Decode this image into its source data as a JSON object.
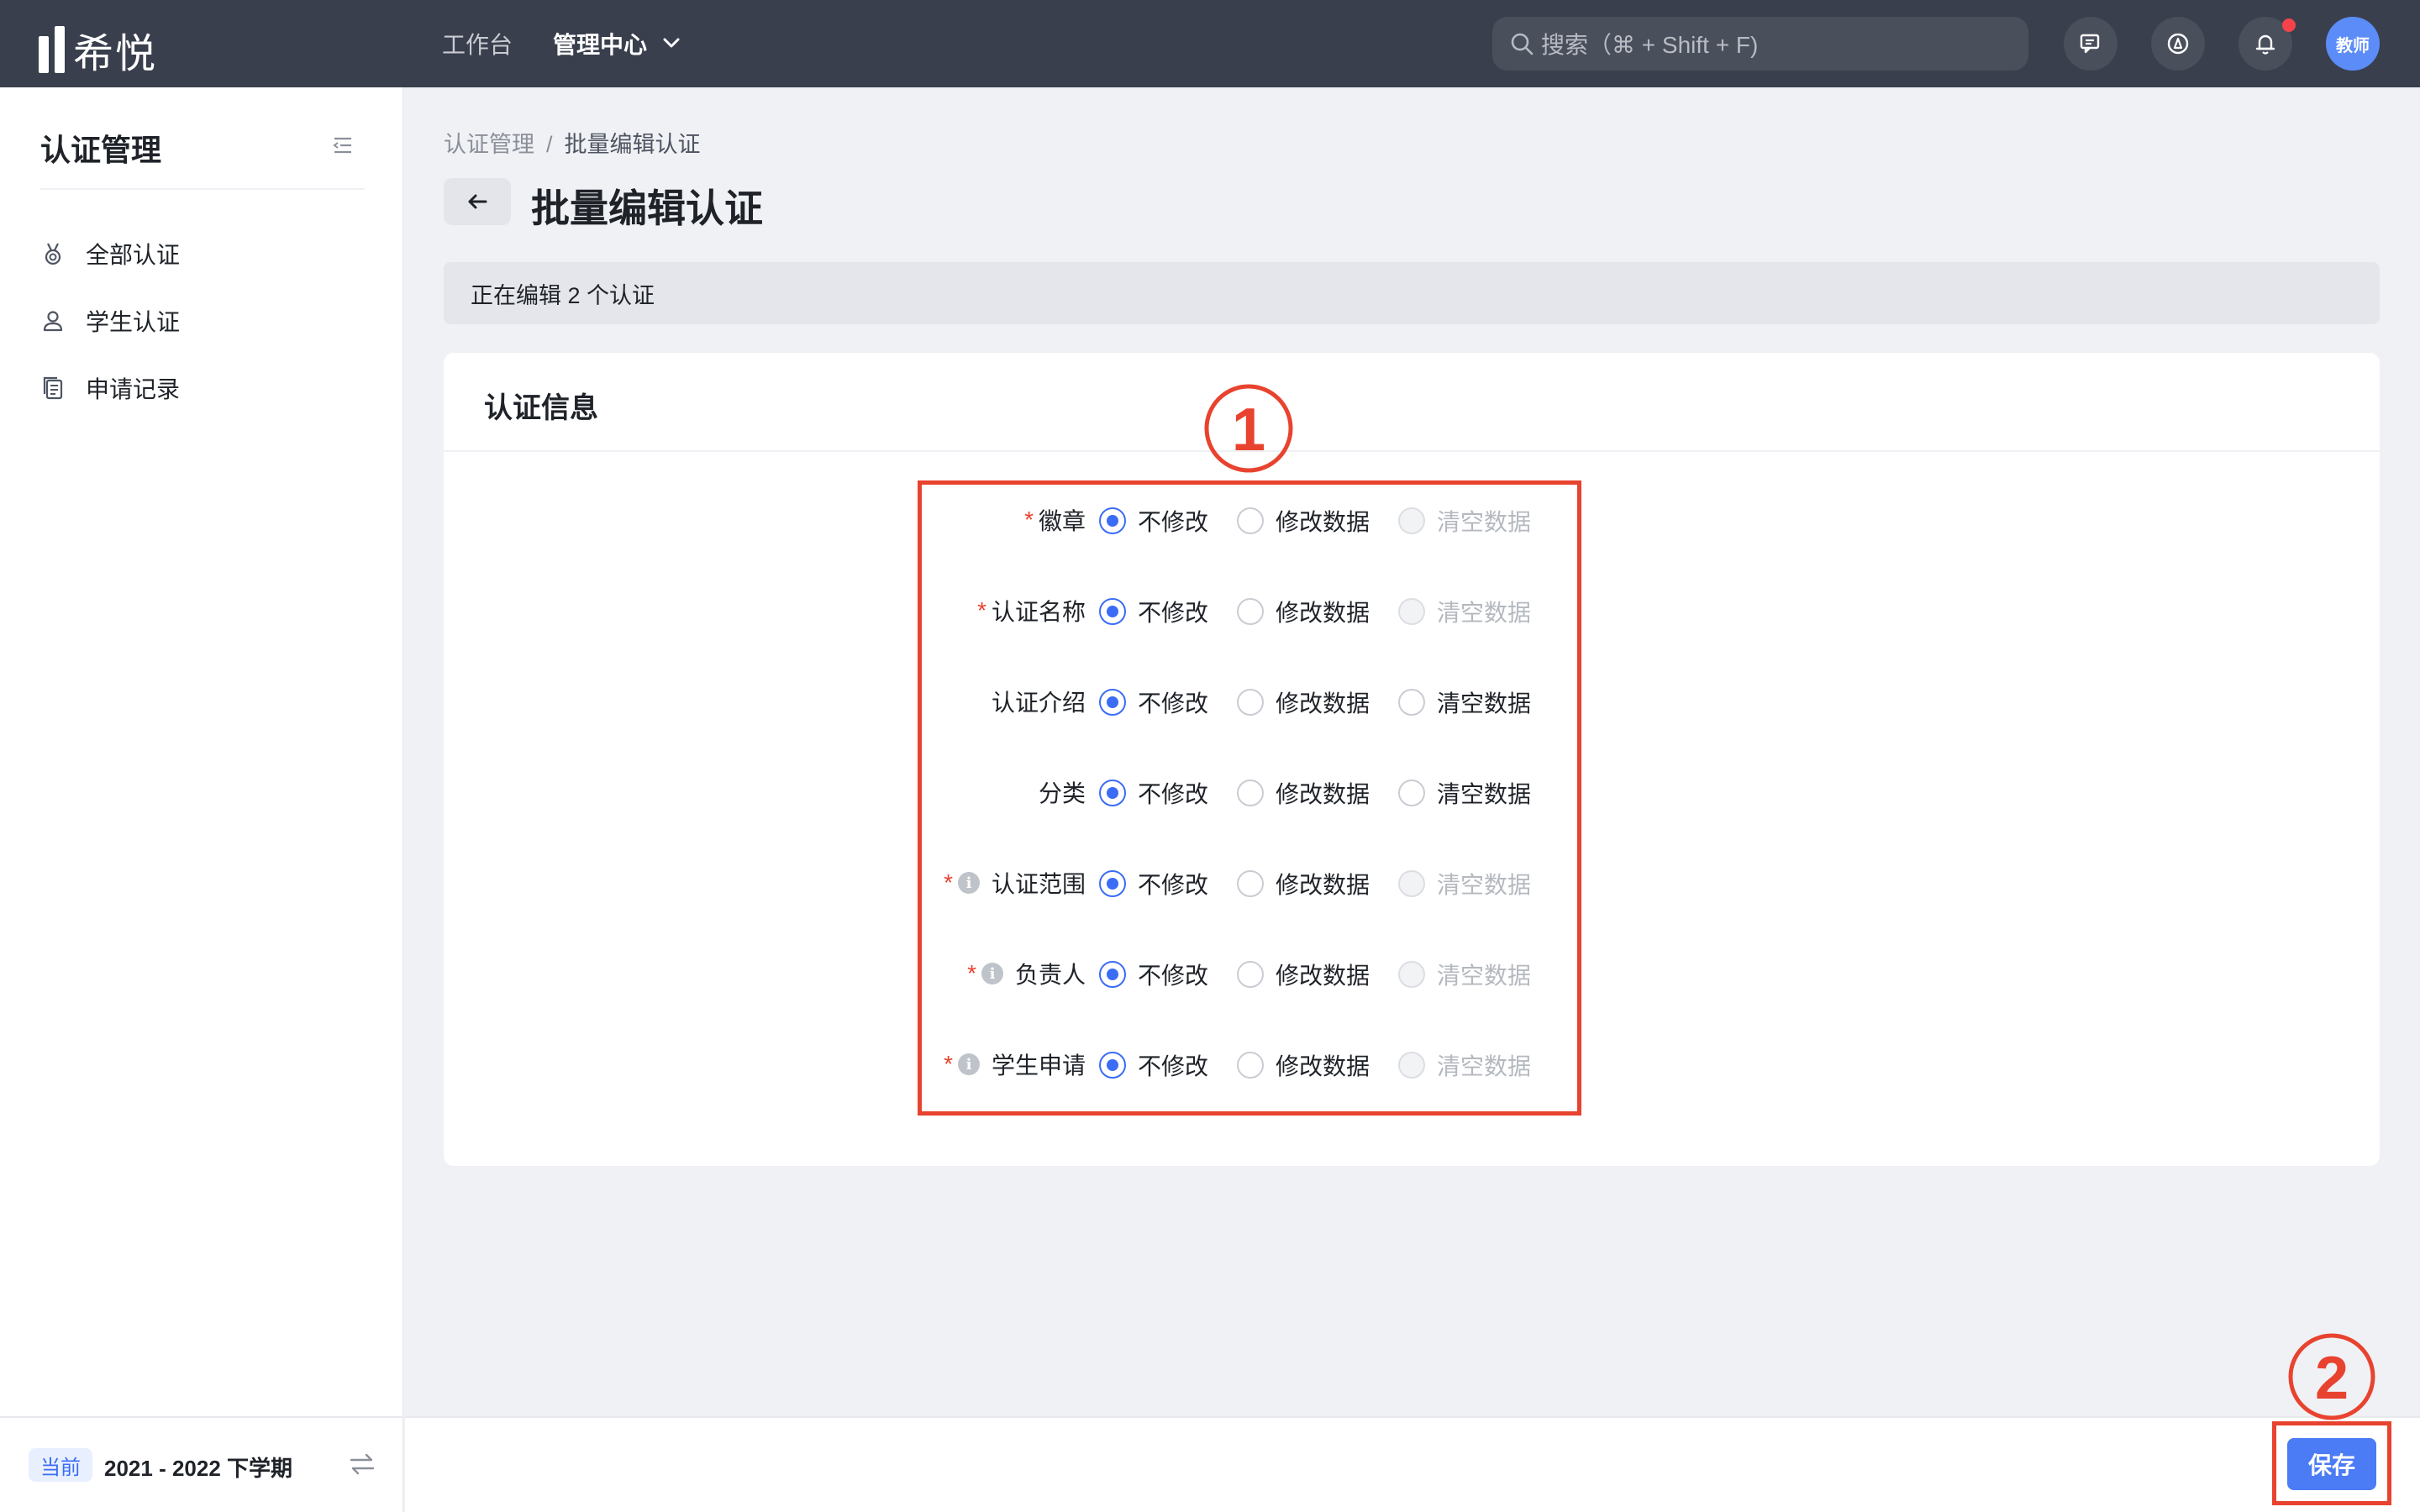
{
  "topbar": {
    "logo_text": "希悦",
    "nav": [
      "工作台",
      "管理中心"
    ],
    "search_placeholder": "搜索（⌘ + Shift + F)",
    "avatar_text": "教师",
    "icons": [
      "chat-icon",
      "compass-icon",
      "bell-icon"
    ],
    "notification_dot_color": "#f5434b"
  },
  "sidebar": {
    "title": "认证管理",
    "items": [
      {
        "label": "全部认证",
        "icon": "medal-icon"
      },
      {
        "label": "学生认证",
        "icon": "user-icon"
      },
      {
        "label": "申请记录",
        "icon": "records-icon"
      }
    ],
    "footer": {
      "badge": "当前",
      "term": "2021 - 2022 下学期"
    }
  },
  "breadcrumb": {
    "root": "认证管理",
    "separator": "/",
    "current": "批量编辑认证"
  },
  "page_title": "批量编辑认证",
  "notice": "正在编辑 2 个认证",
  "card": {
    "title": "认证信息",
    "options": [
      "不修改",
      "修改数据",
      "清空数据"
    ],
    "fields": [
      {
        "label": "徽章",
        "required": true,
        "info": false,
        "selected": 0,
        "clear_disabled": true
      },
      {
        "label": "认证名称",
        "required": true,
        "info": false,
        "selected": 0,
        "clear_disabled": true
      },
      {
        "label": "认证介绍",
        "required": false,
        "info": false,
        "selected": 0,
        "clear_disabled": false
      },
      {
        "label": "分类",
        "required": false,
        "info": false,
        "selected": 0,
        "clear_disabled": false
      },
      {
        "label": "认证范围",
        "required": true,
        "info": true,
        "selected": 0,
        "clear_disabled": true
      },
      {
        "label": "负责人",
        "required": true,
        "info": true,
        "selected": 0,
        "clear_disabled": true
      },
      {
        "label": "学生申请",
        "required": true,
        "info": true,
        "selected": 0,
        "clear_disabled": true
      }
    ]
  },
  "footer": {
    "save_label": "保存"
  },
  "annotations": {
    "marker1": "①",
    "marker2": "②",
    "color": "#e8432f"
  },
  "colors": {
    "accent": "#3b6cf5",
    "topbar": "#3a3f4d",
    "required": "#e8432f"
  }
}
